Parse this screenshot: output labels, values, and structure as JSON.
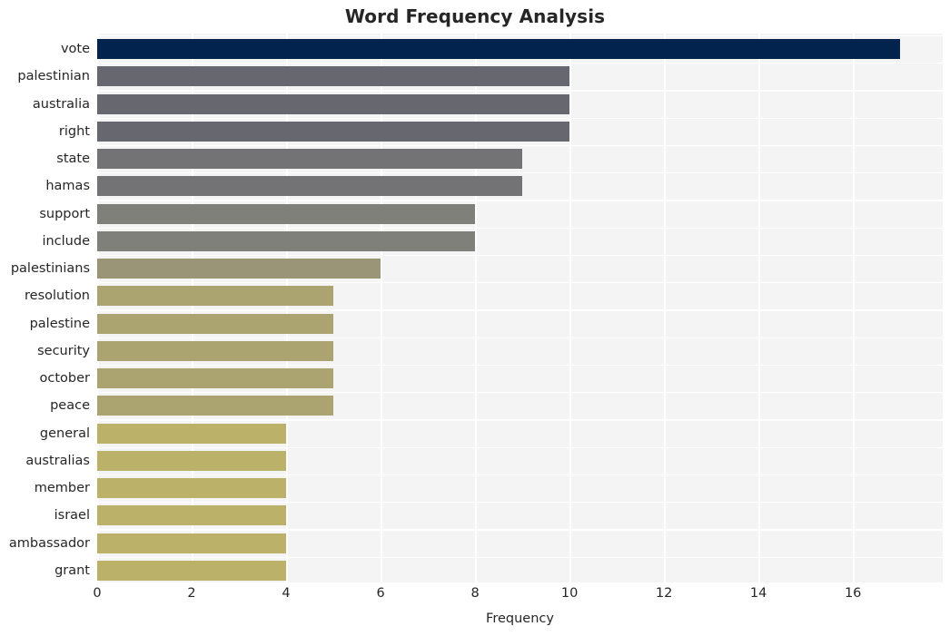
{
  "chart_data": {
    "type": "bar",
    "orientation": "horizontal",
    "title": "Word Frequency Analysis",
    "xlabel": "Frequency",
    "ylabel": "",
    "categories": [
      "vote",
      "palestinian",
      "australia",
      "right",
      "state",
      "hamas",
      "support",
      "include",
      "palestinians",
      "resolution",
      "palestine",
      "security",
      "october",
      "peace",
      "general",
      "australias",
      "member",
      "israel",
      "ambassador",
      "grant"
    ],
    "values": [
      17,
      10,
      10,
      10,
      9,
      9,
      8,
      8,
      6,
      5,
      5,
      5,
      5,
      5,
      4,
      4,
      4,
      4,
      4,
      4
    ],
    "bar_colors": [
      "#03234f",
      "#67676f",
      "#67676f",
      "#67676f",
      "#737376",
      "#737376",
      "#80807a",
      "#80807a",
      "#9b9577",
      "#aba471",
      "#aba471",
      "#aba471",
      "#aba471",
      "#aba471",
      "#bcb169",
      "#bcb169",
      "#bcb169",
      "#bcb169",
      "#bcb169",
      "#bcb169"
    ],
    "xlim": [
      0,
      17.9
    ],
    "xticks": [
      0,
      2,
      4,
      6,
      8,
      10,
      12,
      14,
      16
    ],
    "xticklabels": [
      "0",
      "2",
      "4",
      "6",
      "8",
      "10",
      "12",
      "14",
      "16"
    ],
    "grid": true,
    "grid_color": "#ffffff",
    "plot_background": "#f4f4f5",
    "figure_background": "#ffffff",
    "text_color": "#262626",
    "legend": null,
    "style": "seaborn-whitegrid"
  }
}
